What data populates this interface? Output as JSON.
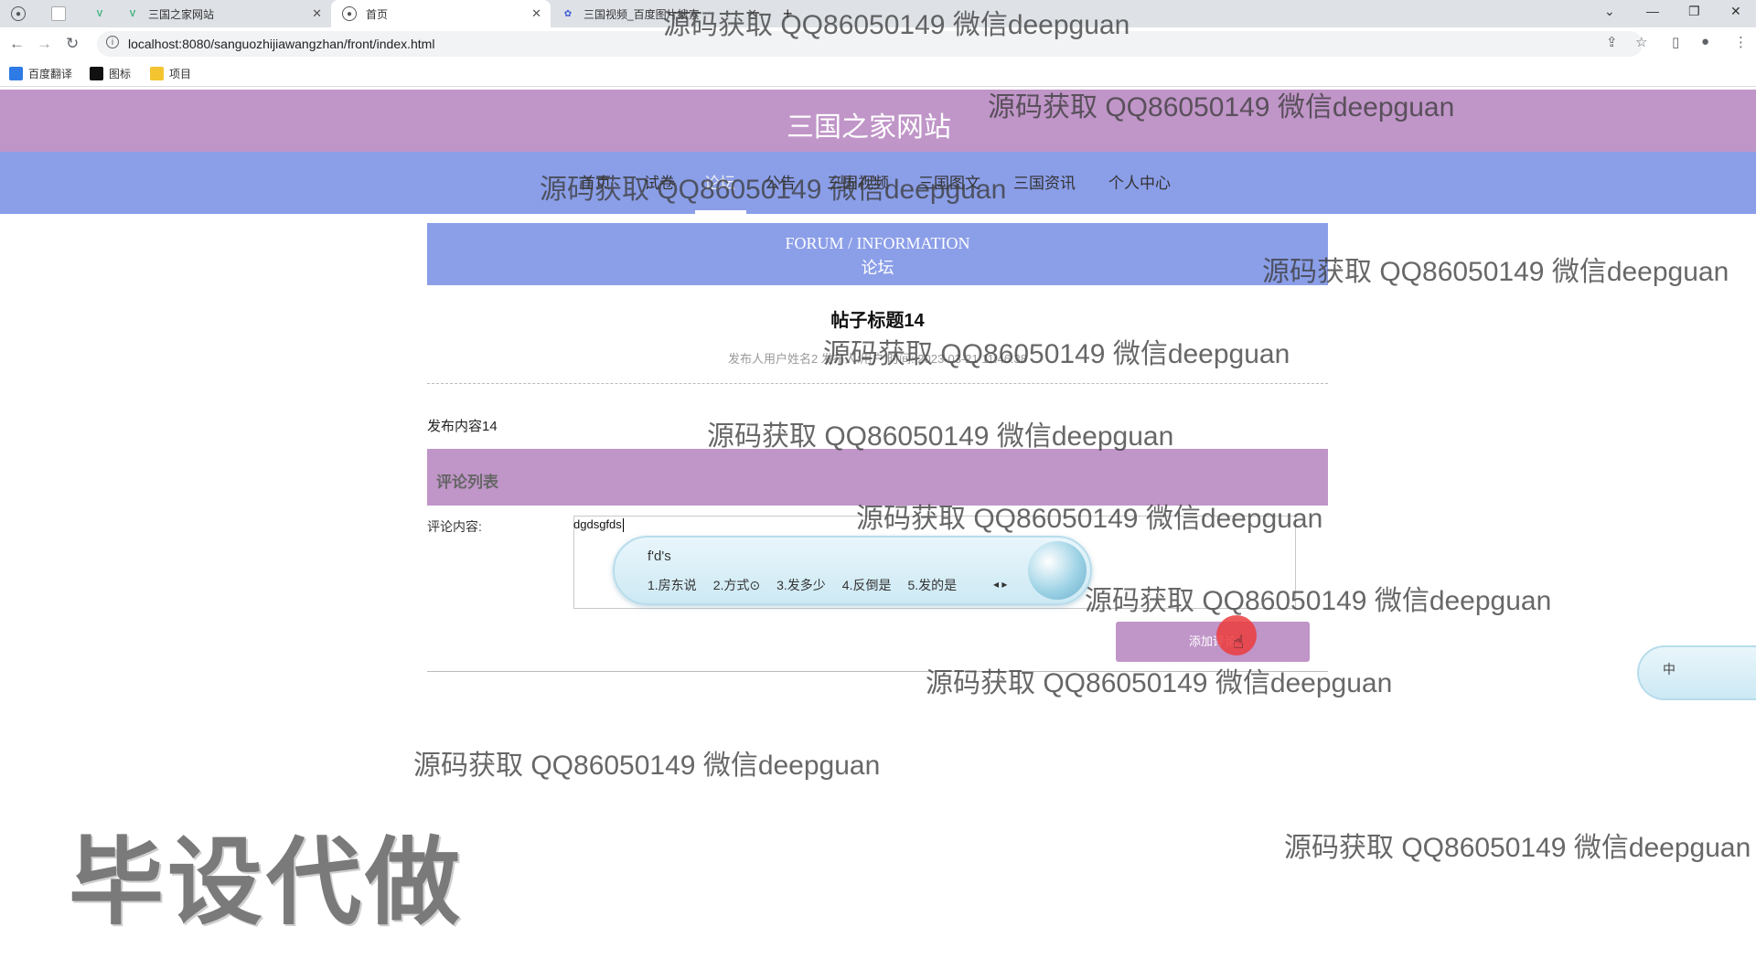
{
  "browser": {
    "tabs": [
      {
        "title": ""
      },
      {
        "title": ""
      },
      {
        "title": "三国之家网站"
      },
      {
        "title": "首页"
      },
      {
        "title": "三国视频_百度图片搜索"
      }
    ],
    "url": "localhost:8080/sanguozhijiawangzhan/front/index.html",
    "bookmarks": [
      "百度翻译",
      "图标",
      "项目"
    ]
  },
  "site": {
    "title": "三国之家网站",
    "nav": [
      "首页",
      "试卷",
      "论坛",
      "公告",
      "三国视频",
      "三国图文",
      "三国资讯",
      "个人中心"
    ],
    "active_nav": "论坛"
  },
  "forum": {
    "banner_en": "FORUM / INFORMATION",
    "banner_cn": "论坛",
    "post_title": "帖子标题14",
    "post_meta": "发布人用户姓名2   发布人:用户   时间: 2023-03-21 11:46:38",
    "post_content": "发布内容14",
    "comment_list_label": "评论列表",
    "comment_field_label": "评论内容:",
    "comment_value": "dgdsgfds",
    "add_button": "添加评论"
  },
  "ime": {
    "pinyin": "f'd's",
    "candidates": [
      "1.房东说",
      "2.方式⊙",
      "3.发多少",
      "4.反倒是",
      "5.发的是"
    ],
    "float_label": "中"
  },
  "watermark": "源码获取 QQ86050149 微信deepguan",
  "stamp": "毕设代做"
}
